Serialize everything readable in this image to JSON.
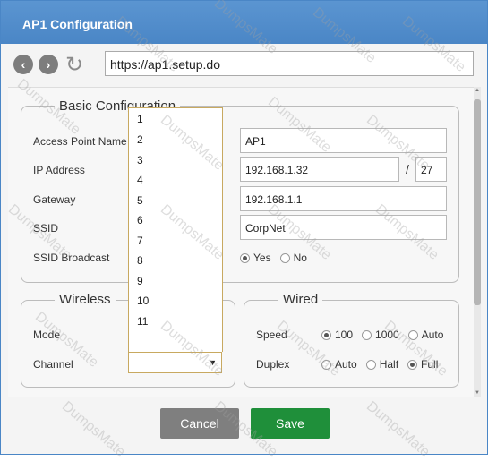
{
  "window": {
    "title": "AP1 Configuration"
  },
  "browser": {
    "url": "https://ap1.setup.do",
    "back_icon": "arrow-left-icon",
    "forward_icon": "arrow-right-icon",
    "refresh_icon": "refresh-icon"
  },
  "basic": {
    "legend": "Basic Configuration",
    "ap_name_label": "Access Point Name",
    "ap_name_value": "AP1",
    "ip_label": "IP Address",
    "ip_value": "192.168.1.32",
    "ip_sep": "/",
    "ip_mask": "27",
    "gateway_label": "Gateway",
    "gateway_value": "192.168.1.1",
    "ssid_label": "SSID",
    "ssid_value": "CorpNet",
    "broadcast_label": "SSID Broadcast",
    "broadcast_options": [
      "Yes",
      "No"
    ],
    "broadcast_selected": "Yes"
  },
  "wireless": {
    "legend": "Wireless",
    "mode_label": "Mode",
    "channel_label": "Channel",
    "channel_value": "",
    "channel_options": [
      "1",
      "2",
      "3",
      "4",
      "5",
      "6",
      "7",
      "8",
      "9",
      "10",
      "11"
    ]
  },
  "wired": {
    "legend": "Wired",
    "speed_label": "Speed",
    "speed_options": [
      "100",
      "1000",
      "Auto"
    ],
    "speed_selected": "100",
    "duplex_label": "Duplex",
    "duplex_options": [
      "Auto",
      "Half",
      "Full"
    ],
    "duplex_selected": "Full"
  },
  "footer": {
    "cancel_label": "Cancel",
    "save_label": "Save"
  },
  "watermark": "DumpsMate",
  "colors": {
    "titlebar": "#4a86c6",
    "save": "#1f8f3a",
    "cancel": "#7f7f7f"
  }
}
